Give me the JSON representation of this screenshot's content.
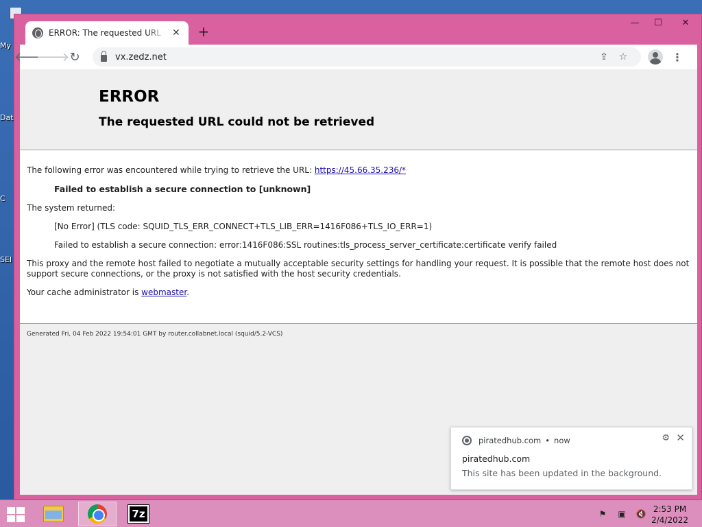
{
  "desktop": {
    "labels": [
      "My",
      "Dat",
      "C",
      "SEI"
    ]
  },
  "browser": {
    "tab_title": "ERROR: The requested URL could not be retrieved",
    "new_tab_symbol": "+",
    "url": "vx.zedz.net",
    "window_controls": {
      "minimize": "—",
      "maximize": "☐",
      "close": "✕"
    }
  },
  "page": {
    "h1": "ERROR",
    "h2": "The requested URL could not be retrieved",
    "intro": "The following error was encountered while trying to retrieve the URL: ",
    "intro_link": "https://45.66.35.236/*",
    "failure": "Failed to establish a secure connection to [unknown]",
    "system_returned": "The system returned:",
    "no_error": "[No Error] (TLS code: SQUID_TLS_ERR_CONNECT+TLS_LIB_ERR=1416F086+TLS_IO_ERR=1)",
    "ssl_detail": "Failed to establish a secure connection: error:1416F086:SSL routines:tls_process_server_certificate:certificate verify failed",
    "explanation": "This proxy and the remote host failed to negotiate a mutually acceptable security settings for handling your request. It is possible that the remote host does not support secure connections, or the proxy is not satisfied with the host security credentials.",
    "cache_admin_prefix": "Your cache administrator is ",
    "cache_admin_link": "webmaster",
    "cache_admin_suffix": ".",
    "footer": "Generated Fri, 04 Feb 2022 19:54:01 GMT by router.collabnet.local (squid/5.2-VCS)"
  },
  "notification": {
    "site": "piratedhub.com",
    "separator": "•",
    "time": "now",
    "title": "piratedhub.com",
    "message": "This site has been updated in the background."
  },
  "taskbar": {
    "apps": [
      "file-explorer",
      "chrome",
      "7-zip"
    ],
    "sevenzip_label": "7z",
    "time": "2:53 PM",
    "date": "2/4/2022"
  },
  "colors": {
    "window_frame": "#d9619f",
    "taskbar": "#dc8fbd",
    "link": "#1a0dab"
  }
}
